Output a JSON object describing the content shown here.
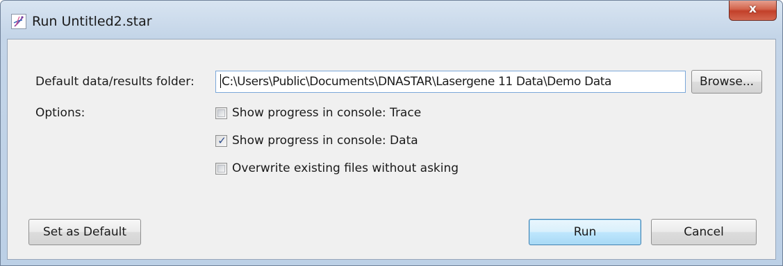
{
  "window": {
    "title": "Run Untitled2.star",
    "close_glyph": "x"
  },
  "form": {
    "folder_label": "Default data/results folder:",
    "folder_value": "C:\\Users\\Public\\Documents\\DNASTAR\\Lasergene 11 Data\\Demo Data",
    "browse_label": "Browse...",
    "options_label": "Options:",
    "options": [
      {
        "label": "Show progress in console: Trace",
        "checked": false
      },
      {
        "label": "Show progress in console: Data",
        "checked": true
      },
      {
        "label": "Overwrite existing files without asking",
        "checked": false
      }
    ]
  },
  "buttons": {
    "set_default_label": "Set as Default",
    "run_label": "Run",
    "cancel_label": "Cancel"
  },
  "icons": {
    "app": "dna-helix-icon",
    "close": "close-icon",
    "check": "checkmark-icon"
  },
  "colors": {
    "title_bar": "#c4d5e8",
    "close_button": "#c2402a",
    "default_button_border": "#3c7fb1",
    "dialog_background": "#f0f0f0"
  }
}
